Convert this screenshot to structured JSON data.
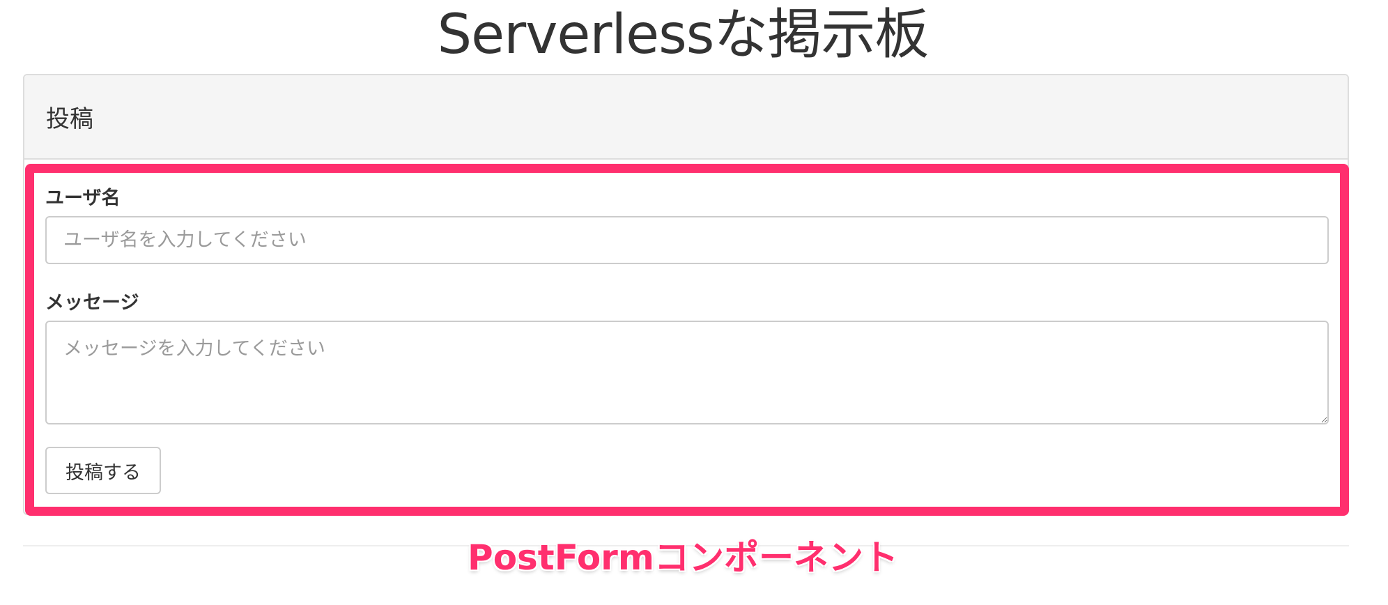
{
  "page": {
    "title": "Serverlessな掲示板"
  },
  "panel": {
    "heading": "投稿"
  },
  "form": {
    "username_label": "ユーザ名",
    "username_placeholder": "ユーザ名を入力してください",
    "username_value": "",
    "message_label": "メッセージ",
    "message_placeholder": "メッセージを入力してください",
    "message_value": "",
    "submit_label": "投稿する"
  },
  "annotation": {
    "text": "PostFormコンポーネント",
    "color": "#ff2f6e"
  },
  "colors": {
    "highlight": "#ff2f6e",
    "heading_bg": "#f5f5f5",
    "border": "#dddddd"
  }
}
